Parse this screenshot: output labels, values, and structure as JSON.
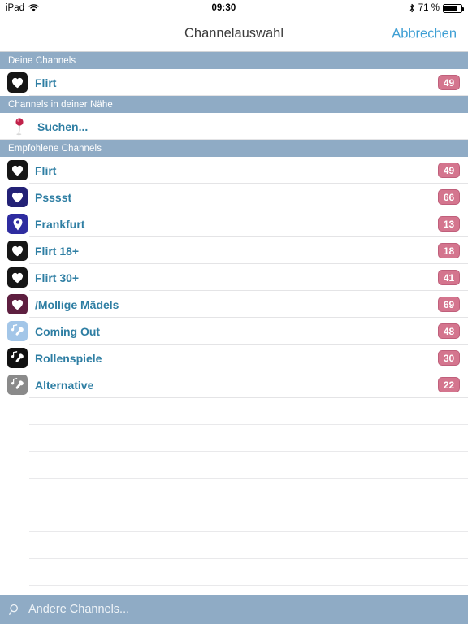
{
  "status_bar": {
    "device": "iPad",
    "wifi_icon": "wifi-icon",
    "time": "09:30",
    "bluetooth_icon": "bluetooth-icon",
    "battery_percent": "71 %",
    "battery_icon": "battery-icon",
    "battery_level": 71
  },
  "navbar": {
    "title": "Channelauswahl",
    "cancel_label": "Abbrechen"
  },
  "sections": [
    {
      "header": "Deine Channels",
      "rows": [
        {
          "icon": "heart-icon",
          "icon_bg": "#161616",
          "label": "Flirt",
          "badge": "49"
        }
      ]
    },
    {
      "header": "Channels in deiner Nähe",
      "rows": [
        {
          "icon": "map-pin-icon",
          "label": "Suchen...",
          "badge": null
        }
      ]
    },
    {
      "header": "Empfohlene Channels",
      "rows": [
        {
          "icon": "heart-icon",
          "icon_bg": "#161616",
          "label": "Flirt",
          "badge": "49"
        },
        {
          "icon": "heart-icon",
          "icon_bg": "#232176",
          "label": "Psssst",
          "badge": "66"
        },
        {
          "icon": "location-pin-icon",
          "icon_bg": "#2e2ca0",
          "label": "Frankfurt",
          "badge": "13"
        },
        {
          "icon": "heart-icon",
          "icon_bg": "#161616",
          "label": "Flirt 18+",
          "badge": "18"
        },
        {
          "icon": "heart-icon",
          "icon_bg": "#161616",
          "label": "Flirt 30+",
          "badge": "41"
        },
        {
          "icon": "heart-icon",
          "icon_bg": "#5e1f40",
          "label": "/Mollige Mädels",
          "badge": "69"
        },
        {
          "icon": "karaoke-icon",
          "icon_bg": "#a3c6e8",
          "label": "Coming Out",
          "badge": "48"
        },
        {
          "icon": "karaoke-icon",
          "icon_bg": "#111111",
          "label": "Rollenspiele",
          "badge": "30"
        },
        {
          "icon": "karaoke-icon",
          "icon_bg": "#8a8a8a",
          "label": "Alternative",
          "badge": "22"
        }
      ]
    }
  ],
  "empty_row_count": 8,
  "bottom_bar": {
    "search_icon": "search-icon",
    "label": "Andere Channels..."
  },
  "colors": {
    "section_header_bg": "#8fabc5",
    "row_label": "#2e7ea3",
    "badge_bg": "#d4758e",
    "badge_border": "#c05f7b",
    "nav_action": "#3e9fd4",
    "separator": "#e4e4e6"
  }
}
